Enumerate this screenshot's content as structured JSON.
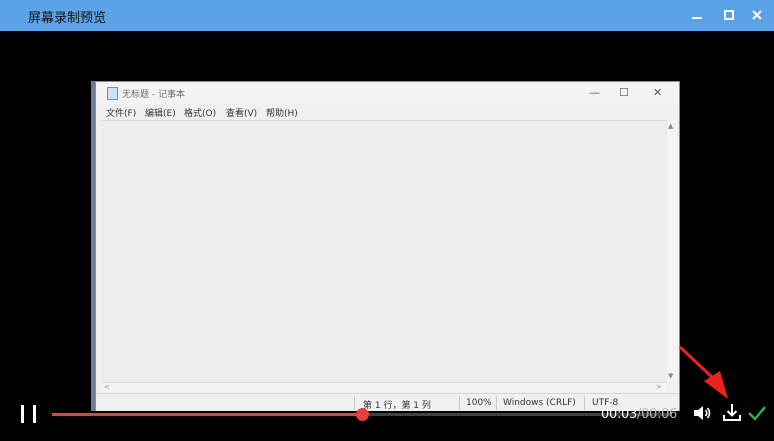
{
  "window": {
    "title": "屏幕录制预览"
  },
  "notepad": {
    "title": "无标题 - 记事本",
    "controls": {
      "minimize": "—",
      "maximize": "☐",
      "close": "✕"
    },
    "menu": [
      "文件(F)",
      "编辑(E)",
      "格式(O)",
      "查看(V)",
      "帮助(H)"
    ],
    "scroll_glyphs": {
      "up": "▲",
      "down": "▼",
      "left": "<",
      "right": ">"
    },
    "status": {
      "position": "第 1 行，第 1 列",
      "zoom": "100%",
      "line_ending": "Windows (CRLF)",
      "encoding": "UTF-8"
    }
  },
  "player": {
    "current_time": "00:03",
    "separator": "/",
    "total_time": "00:06",
    "progress": 0.5,
    "colors": {
      "progress": "#e8403a",
      "confirm": "#36b24a",
      "titlebar": "#5aa3e6"
    },
    "icons": [
      "pause-icon",
      "volume-icon",
      "download-icon",
      "checkmark-icon"
    ]
  }
}
